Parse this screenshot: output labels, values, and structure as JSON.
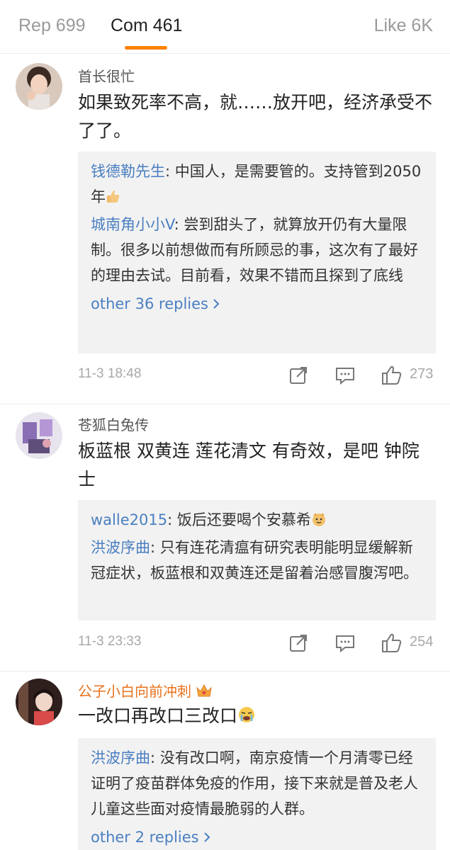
{
  "tabs": {
    "reposts": "Rep 699",
    "comments": "Com 461",
    "likes": "Like 6K"
  },
  "colors": {
    "accent": "#ff8200",
    "link": "#4a7fc1",
    "vip_name": "#e8721c",
    "reply_bg": "#f2f2f2"
  },
  "comments": [
    {
      "username": "首长很忙",
      "content": "如果致死率不高，就……放开吧，经济承受不了了。",
      "replies": [
        {
          "name": "钱德勒先生",
          "text": ": 中国人，是需要管的。支持管到2050年",
          "emoji": "thumbs-up-emoji"
        },
        {
          "name": "城南角小小V",
          "text": ": 尝到甜头了，就算放开仍有大量限制。很多以前想做而有所顾忌的事，这次有了最好的理由去试。目前看，效果不错而且探到了底线"
        }
      ],
      "more_replies": "other 36 replies",
      "time": "11-3 18:48",
      "likes": "273"
    },
    {
      "username": "苍狐白兔传",
      "content": "板蓝根 双黄连 莲花清文 有奇效，是吧 钟院士",
      "replies": [
        {
          "name": "walle2015",
          "text": ": 饭后还要喝个安慕希",
          "emoji": "smirk-dog-emoji"
        },
        {
          "name": "洪波序曲",
          "text": ": 只有连花清瘟有研究表明能明显缓解新冠症状，板蓝根和双黄连还是留着治感冒腹泻吧。"
        }
      ],
      "time": "11-3 23:33",
      "likes": "254"
    },
    {
      "username": "公子小白向前冲刺",
      "content": "一改口再改口三改口",
      "replies": [
        {
          "name": "洪波序曲",
          "text": ": 没有改口啊，南京疫情一个月清零已经证明了疫苗群体免疫的作用，接下来就是普及老人儿童这些面对疫情最脆弱的人群。"
        }
      ],
      "more_replies": "other 2 replies"
    }
  ]
}
